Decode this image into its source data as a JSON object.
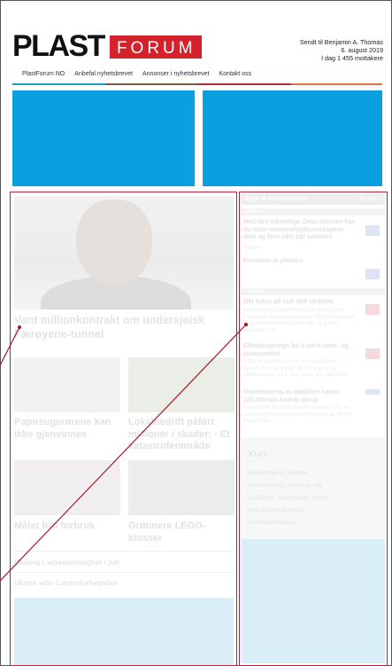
{
  "header": {
    "logo_plast": "PLAST",
    "logo_forum": "FORUM",
    "sender_line1": "Sendt til Benjamin A. Thomas",
    "sender_line2": "6. august 2019",
    "sender_line3": "I dag 1 455 mottakere"
  },
  "nav": {
    "items": [
      "PlastForum NO",
      "Anbefal nyhetsbrevet",
      "Annonser i nyhetsbrevet",
      "Kontakt oss"
    ],
    "bar_colors": [
      "#1aa0c8",
      "#7a5a3a",
      "#b22b3c",
      "#e0753a"
    ]
  },
  "ads": {
    "color": "#0aa0e0"
  },
  "main": {
    "hero_title": "Vant millionkontrakt om undersjøisk Færøyene-tunnel",
    "stories": [
      {
        "title": "Papirsugerørene kan ikke gjenvinnes"
      },
      {
        "title": "Lokalbedrift påført millioner i skader: - Et katastrofeområde"
      },
      {
        "title": "Målet fritt forbruk"
      },
      {
        "title": "Grønnere LEGO-klosser"
      }
    ],
    "links": [
      "Økning i arbeidsledighet i juli",
      "Ukens vits: Lønnsforhøyelse"
    ]
  },
  "sidebar": {
    "header_label": "Stryk & redaksjonelle",
    "header_right": "Se alle ›",
    "sub1": "Siste nytt",
    "items1": [
      {
        "title": "Med den månedlige Zeiss-kvissen kan du teste meteorologikunnskapene dine og feire vårt 100 jubileum",
        "text": "Rådgivt"
      },
      {
        "title": "Precision in plastics",
        "text": ""
      }
    ],
    "sub2": "Arkivsøk",
    "items2": [
      {
        "title": "Økt fokus på null skill idriftene",
        "text": "Med aktivitet i fagseminaret får stadig flere kommuner og organisasjoner riktig kompetanse for å skaffe kontroller over nye og gamle aktiviteter i for"
      },
      {
        "title": "Effektiviserings for å sikre vann- og avløpsnettet",
        "text": "Dette er kommune et en av kommunene i Norge som har anmet og tatt smarte og effektive grep for å sikre vann- og avløpsnett."
      },
      {
        "title": "Overdosering av additiver koster 100.000-tals kronor per år",
        "text": "Leverandør benytter plastprodusenter ofte en overdosert forbindelse ved tillsetting av 30 % i en gammel..."
      }
    ],
    "kurs_title": "Kurs",
    "kurs_items": [
      "Arbeidsmiljø og sikkerhet",
      "Automatisering, styring og miljø",
      "CAD/CAM - Konstruksjon - Design",
      "Miljø, kvalitet og revisjon",
      "Overflatebehandling"
    ],
    "icon_color": "#5a6cc8",
    "icon_color_red": "#d4222d"
  },
  "annotation_color": "#a8162e"
}
